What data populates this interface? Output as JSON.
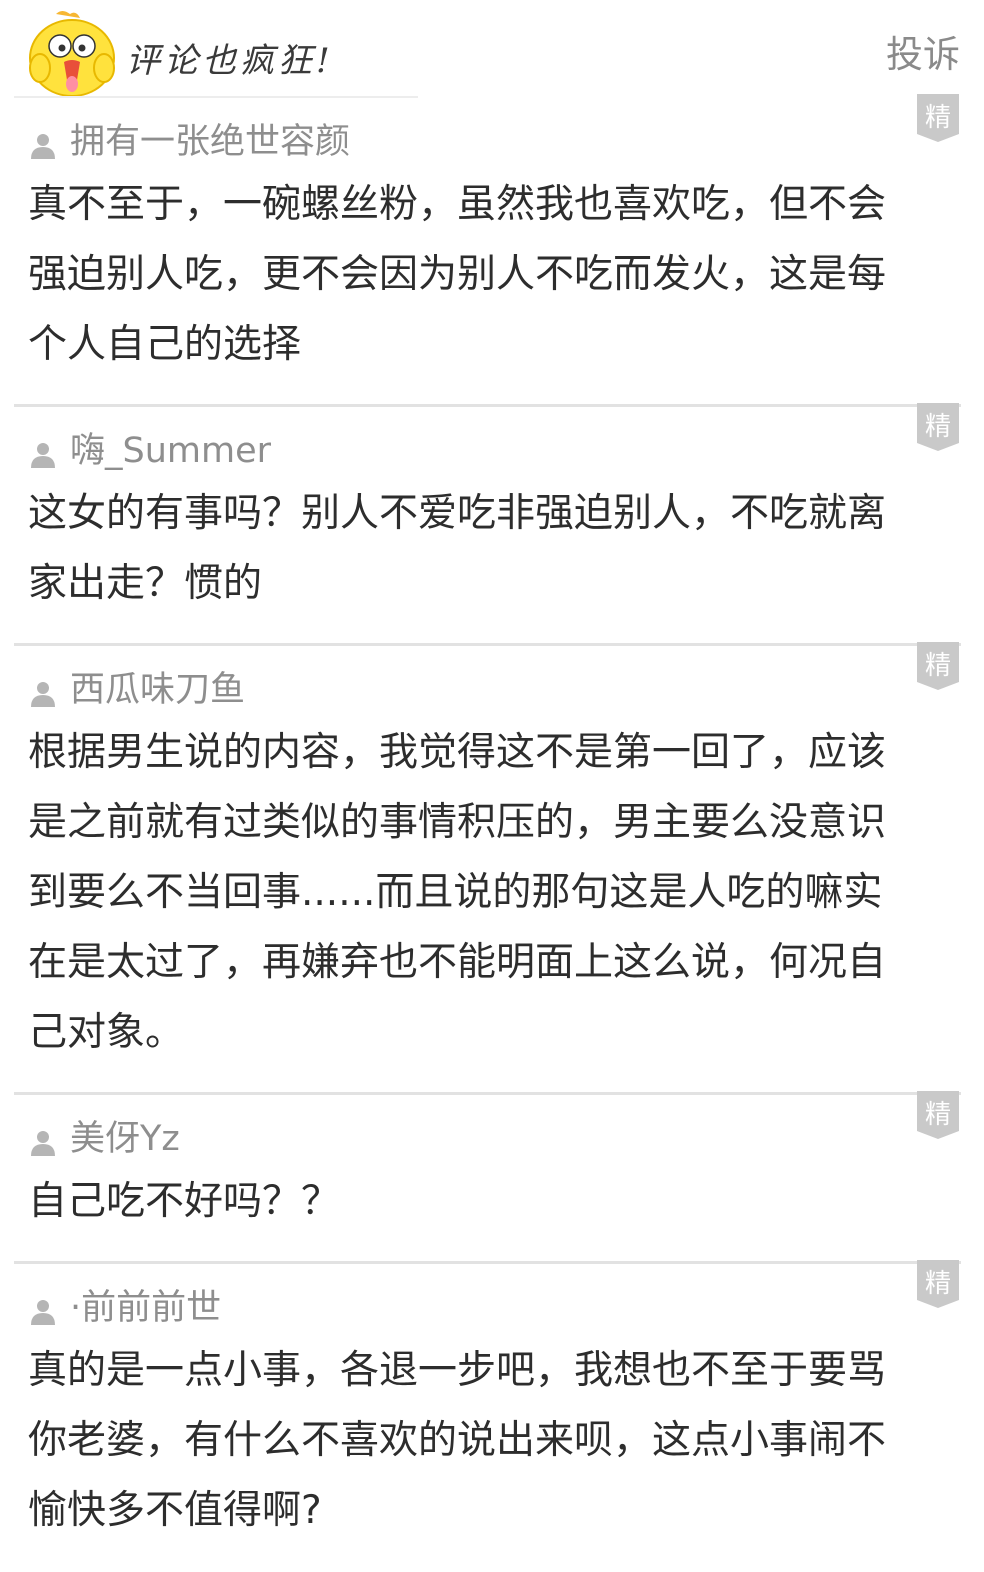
{
  "header": {
    "title": "评论也疯狂!",
    "report_label": "投诉",
    "mascot_icon": "chick-mascot-icon"
  },
  "badge_label": "精",
  "colors": {
    "badge_fill": "#c9c9c9",
    "username": "#8e8e8e",
    "text": "#2d2d2d",
    "divider": "#e2e2e2"
  },
  "comments": [
    {
      "username": "拥有一张绝世容颜",
      "text": "真不至于，一碗螺丝粉，虽然我也喜欢吃，但不会强迫别人吃，更不会因为别人不吃而发火，这是每个人自己的选择"
    },
    {
      "username": "嗨_Summer",
      "text": "这女的有事吗？别人不爱吃非强迫别人，不吃就离家出走？惯的"
    },
    {
      "username": "西瓜味刀鱼",
      "text": "根据男生说的内容，我觉得这不是第一回了，应该是之前就有过类似的事情积压的，男主要么没意识到要么不当回事......而且说的那句这是人吃的嘛实在是太过了，再嫌弃也不能明面上这么说，何况自己对象。"
    },
    {
      "username": "美伢Yz",
      "text": "自己吃不好吗？？"
    },
    {
      "username": "·前前前世",
      "text": "真的是一点小事，各退一步吧，我想也不至于要骂你老婆，有什么不喜欢的说出来呗，这点小事闹不愉快多不值得啊?"
    }
  ]
}
